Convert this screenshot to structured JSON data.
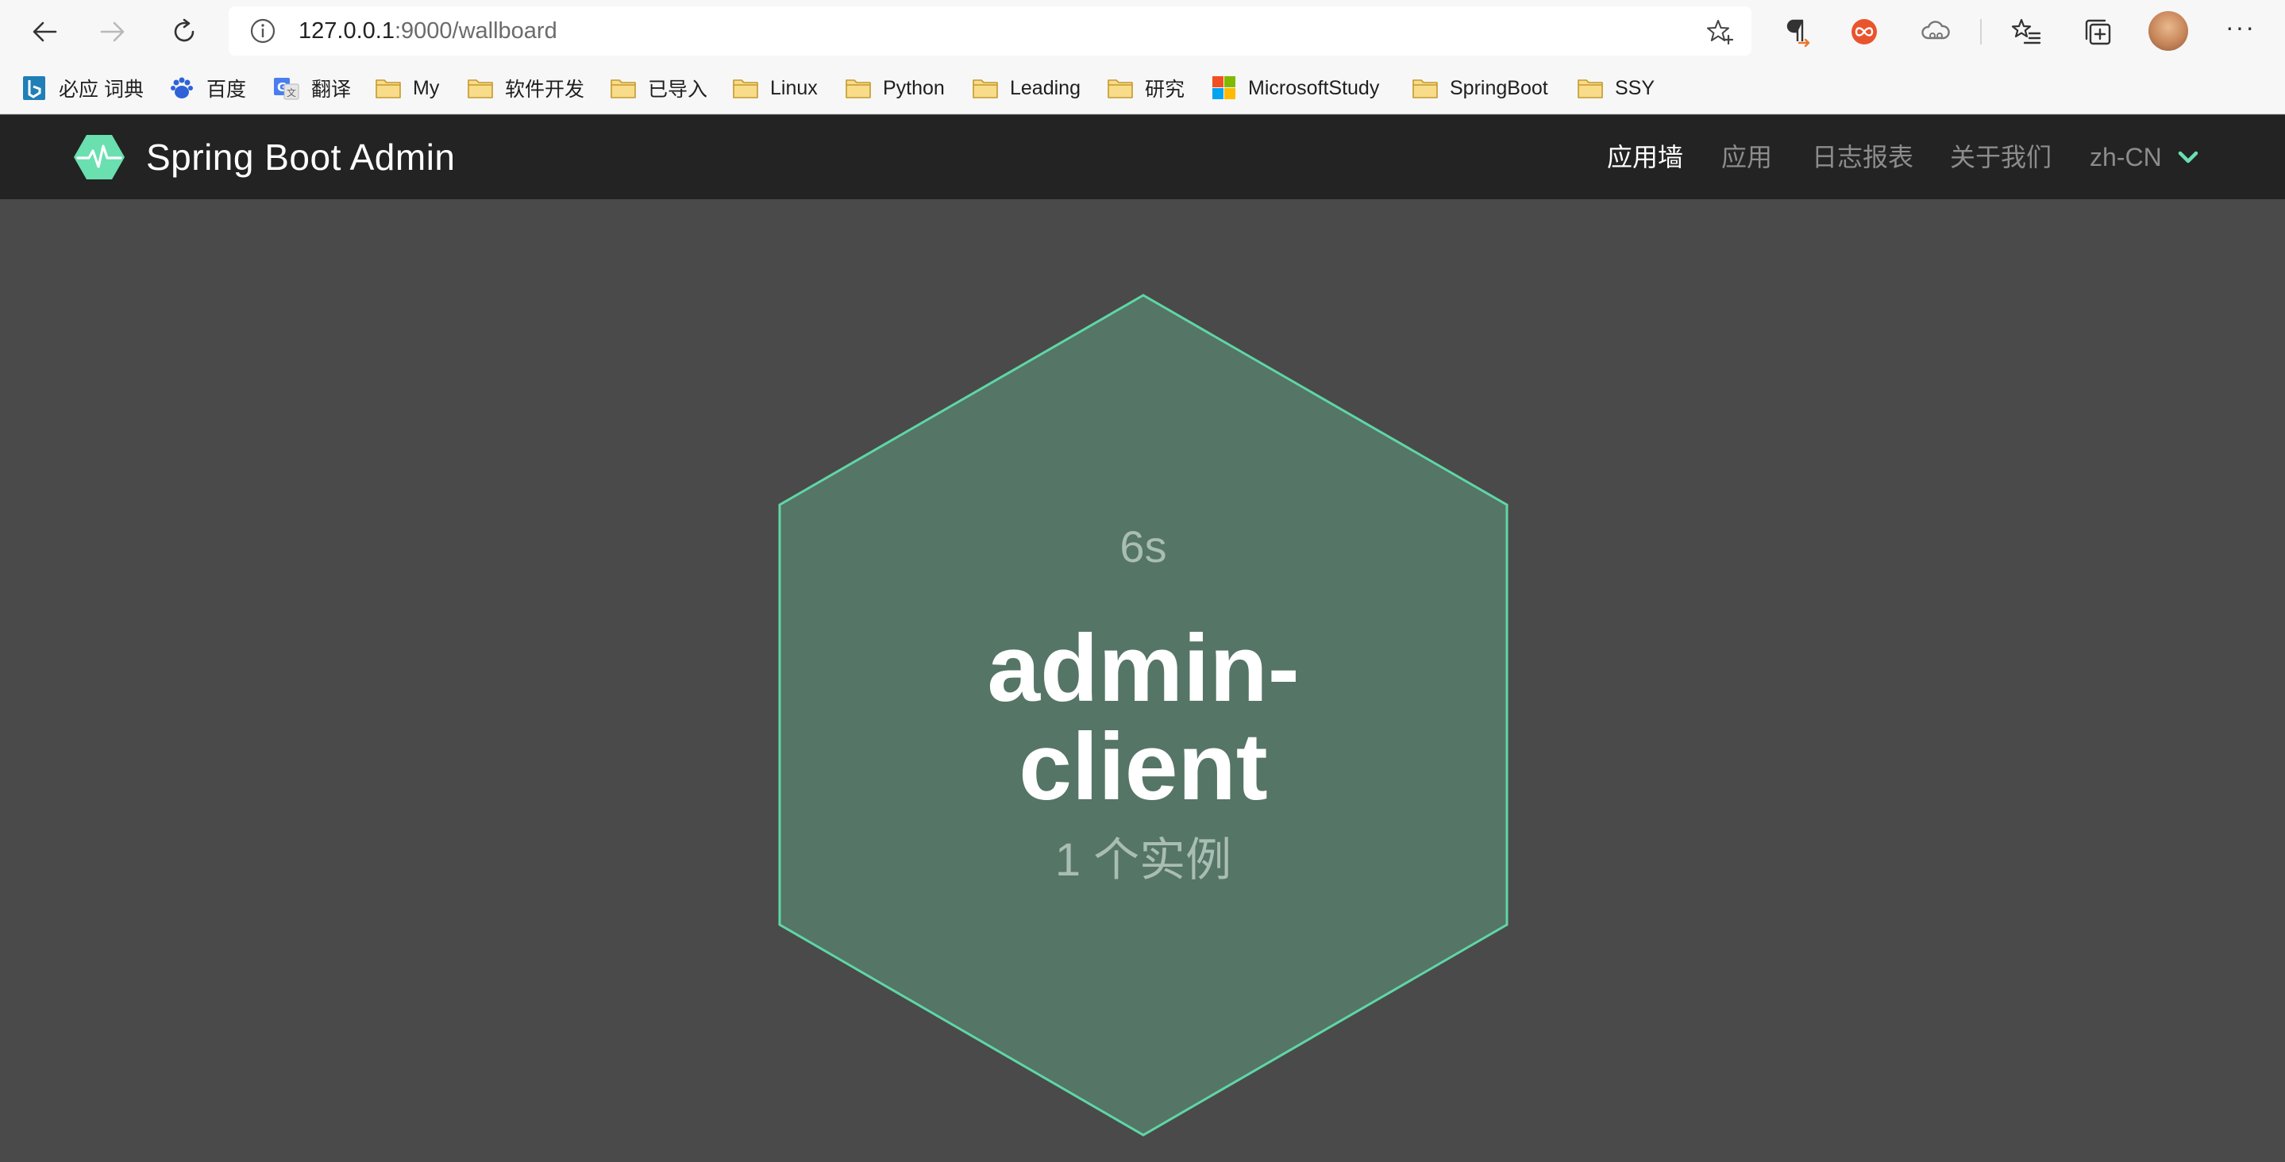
{
  "browser": {
    "url_host": "127.0.0.1",
    "url_path": ":9000/wallboard",
    "icons": {
      "back": "back-arrow-icon",
      "forward": "forward-arrow-icon",
      "refresh": "refresh-icon",
      "site_info": "info-icon",
      "favorite": "star-add-icon",
      "extensions": [
        "paragraph-icon",
        "infinity-icon",
        "cloud-icon"
      ],
      "favorites": "favorites-list-icon",
      "collections": "collections-icon",
      "more": "more-icon"
    },
    "more_label": "···"
  },
  "bookmarks": [
    {
      "label": "必应 词典",
      "icon": "bing-icon"
    },
    {
      "label": "百度",
      "icon": "baidu-paw-icon"
    },
    {
      "label": "翻译",
      "icon": "google-translate-icon"
    },
    {
      "label": "My",
      "icon": "folder-icon"
    },
    {
      "label": "软件开发",
      "icon": "folder-icon"
    },
    {
      "label": "已导入",
      "icon": "folder-icon"
    },
    {
      "label": "Linux",
      "icon": "folder-icon"
    },
    {
      "label": "Python",
      "icon": "folder-icon"
    },
    {
      "label": "Leading",
      "icon": "folder-icon"
    },
    {
      "label": "研究",
      "icon": "folder-icon"
    },
    {
      "label": "MicrosoftStudy",
      "icon": "microsoft-logo-icon"
    },
    {
      "label": "SpringBoot",
      "icon": "folder-icon"
    },
    {
      "label": "SSY",
      "icon": "folder-icon"
    }
  ],
  "app": {
    "brand": "Spring Boot Admin",
    "nav": {
      "wallboard": "应用墙",
      "applications": "应用",
      "journal": "日志报表",
      "about": "关于我们",
      "language": "zh-CN"
    },
    "colors": {
      "accent": "#6adfb0",
      "header_bg": "#232323",
      "wall_bg": "#4a4a4a",
      "tile_fill": "#557566",
      "tile_stroke": "#5fd6a6"
    }
  },
  "wallboard": {
    "tile": {
      "duration": "6s",
      "name": "admin-client",
      "instances": "1 个实例",
      "status": "UP"
    }
  }
}
